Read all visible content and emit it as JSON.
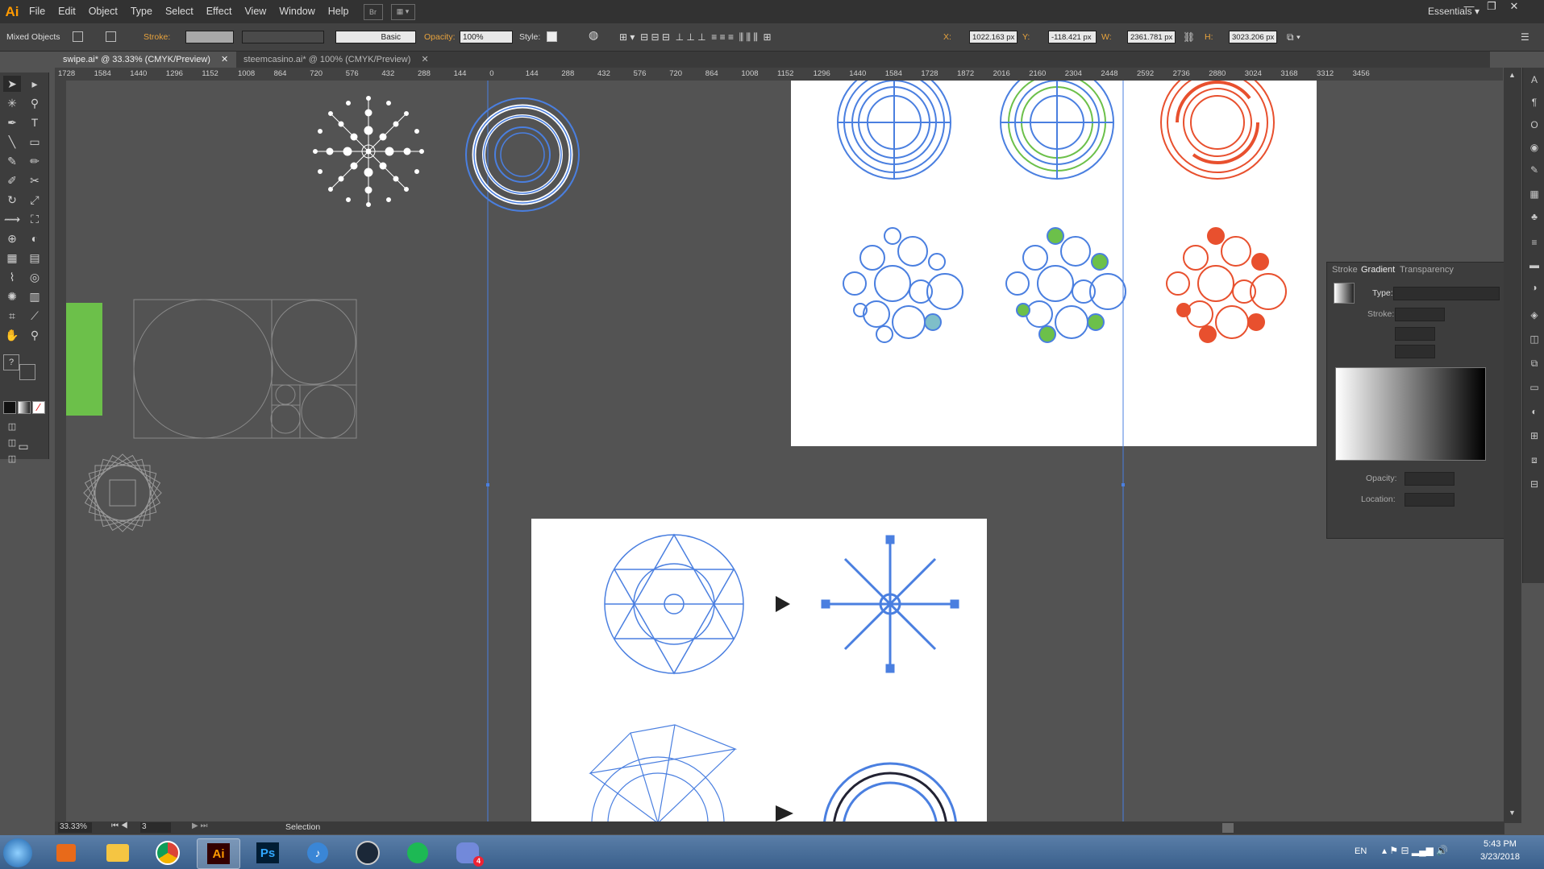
{
  "app": {
    "logo": "Ai",
    "workspace": "Essentials ▾"
  },
  "menu": [
    "File",
    "Edit",
    "Object",
    "Type",
    "Select",
    "Effect",
    "View",
    "Window",
    "Help"
  ],
  "menu_extras": {
    "br": "Br",
    "arrange": "▦ ▾"
  },
  "window_buttons": [
    "—",
    "❐",
    "✕"
  ],
  "control_bar": {
    "selection": "Mixed Objects",
    "stroke_label": "Stroke:",
    "brush": "Basic",
    "opacity_label": "Opacity:",
    "opacity_value": "100%",
    "style_label": "Style:",
    "x_label": "X:",
    "x_value": "1022.163 px",
    "y_label": "Y:",
    "y_value": "-118.421 px",
    "w_label": "W:",
    "w_value": "2361.781 px",
    "h_label": "H:",
    "h_value": "3023.206 px"
  },
  "tabs": [
    {
      "label": "swipe.ai* @ 33.33% (CMYK/Preview)",
      "close": "✕"
    },
    {
      "label": "steemcasino.ai* @ 100% (CMYK/Preview)",
      "close": "✕"
    }
  ],
  "ruler_ticks": [
    "1728",
    "1584",
    "1440",
    "1296",
    "1152",
    "1008",
    "864",
    "720",
    "576",
    "432",
    "288",
    "144",
    "0",
    "144",
    "288",
    "432",
    "576",
    "720",
    "864",
    "1008",
    "1152",
    "1296",
    "1440",
    "1584",
    "1728",
    "1872",
    "2016",
    "2160",
    "2304",
    "2448",
    "2592",
    "2736",
    "2880",
    "3024",
    "3168",
    "3312",
    "3456"
  ],
  "panel": {
    "tabs": [
      "Stroke",
      "Gradient",
      "Transparency"
    ],
    "type_label": "Type:",
    "stroke_label": "Stroke:",
    "opacity_label": "Opacity:",
    "location_label": "Location:"
  },
  "status": {
    "zoom": "33.33%",
    "page": "3",
    "tool": "Selection"
  },
  "colors": {
    "accent_blue": "#4a7fe0",
    "green": "#6cc04a",
    "orange_red": "#e8502e",
    "panel_bg": "#3d3d3d",
    "canvas_bg": "#535353"
  },
  "taskbar": {
    "apps": [
      "start-orb",
      "media-player",
      "file-explorer",
      "chrome",
      "illustrator",
      "photoshop",
      "itunes",
      "steam",
      "spotify",
      "discord"
    ],
    "illustrator_label": "Ai",
    "photoshop_label": "Ps",
    "discord_badge": "4",
    "lang": "EN",
    "time": "5:43 PM",
    "date": "3/23/2018"
  }
}
